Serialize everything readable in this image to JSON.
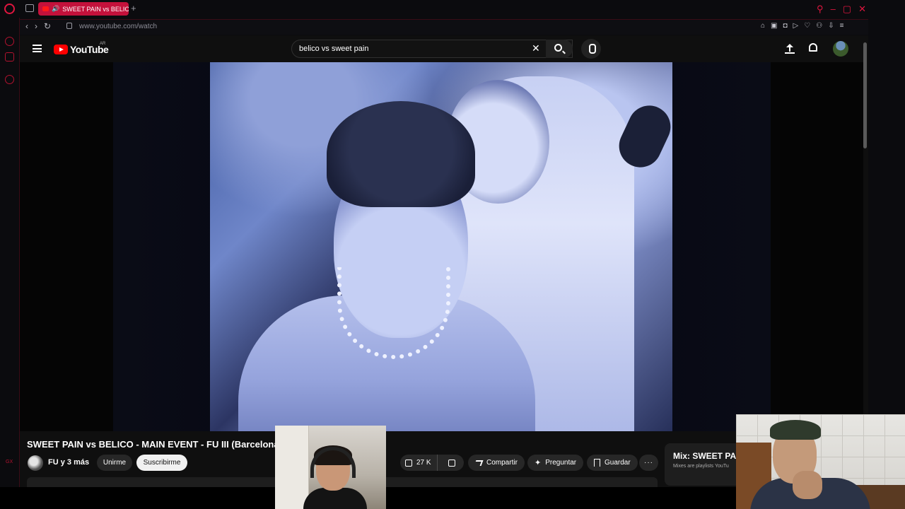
{
  "browser": {
    "tab_title": "SWEET PAIN vs BELICO",
    "url": "www.youtube.com/watch",
    "new_tab": "+",
    "nav": {
      "back": "‹",
      "forward": "›",
      "reload": "↻"
    },
    "window_controls": [
      "⚲",
      "–",
      "▢",
      "✕"
    ],
    "ext_icons": [
      "⌂",
      "▣",
      "◘",
      "▷",
      "♡",
      "⚇",
      "⇩",
      "≡"
    ],
    "accent_color": "#c4113b"
  },
  "youtube": {
    "logo_text": "YouTube",
    "country_code": "AR",
    "search": {
      "value": "belico vs sweet pain",
      "clear": "✕"
    }
  },
  "video": {
    "title": "SWEET PAIN vs BELICO - MAIN EVENT - FU III (Barcelona)",
    "channel": "FU y 3 más",
    "join_label": "Unirme",
    "subscribe_label": "Suscribirme",
    "likes": "27 K",
    "share_label": "Compartir",
    "ask_label": "Preguntar",
    "save_label": "Guardar",
    "more_label": "···"
  },
  "mix": {
    "title": "Mix: SWEET PA",
    "subtitle": "Mixes are playlists YouTu"
  },
  "sidebar_bottom": "GX"
}
